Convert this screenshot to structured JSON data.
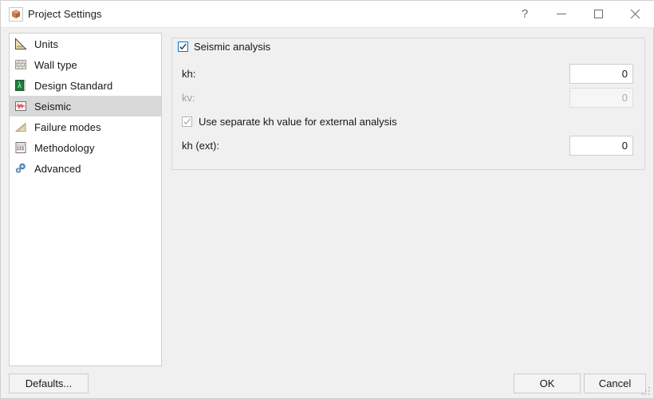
{
  "window": {
    "title": "Project Settings",
    "icon": "app-cube-icon",
    "controls": {
      "help": "?",
      "minimize": "minimize-icon",
      "maximize": "maximize-icon",
      "close": "close-icon"
    }
  },
  "sidebar": {
    "selected_index": 3,
    "items": [
      {
        "label": "Units",
        "icon": "triangle-ruler-icon"
      },
      {
        "label": "Wall type",
        "icon": "brick-wall-icon"
      },
      {
        "label": "Design Standard",
        "icon": "document-standard-icon"
      },
      {
        "label": "Seismic",
        "icon": "seismograph-icon"
      },
      {
        "label": "Failure modes",
        "icon": "slope-icon"
      },
      {
        "label": "Methodology",
        "icon": "calculator-icon"
      },
      {
        "label": "Advanced",
        "icon": "gears-icon"
      }
    ]
  },
  "main": {
    "group": {
      "legend": "Seismic analysis",
      "checked": true,
      "enabled": true
    },
    "fields": [
      {
        "label": "kh:",
        "value": "0",
        "enabled": true
      },
      {
        "label": "kv:",
        "value": "0",
        "enabled": false
      },
      {
        "label": "kh (ext):",
        "value": "0",
        "enabled": true
      }
    ],
    "separate_kh": {
      "label": "Use separate kh value for external analysis",
      "checked": true,
      "enabled": false
    }
  },
  "footer": {
    "defaults_label": "Defaults...",
    "ok_label": "OK",
    "cancel_label": "Cancel"
  },
  "colors": {
    "accent": "#0078d7",
    "window_bg": "#f0f0f0",
    "titlebar_bg": "#ffffff",
    "selection": "#d9d9d9",
    "text": "#171717",
    "disabled_text": "#a0a0a0"
  }
}
